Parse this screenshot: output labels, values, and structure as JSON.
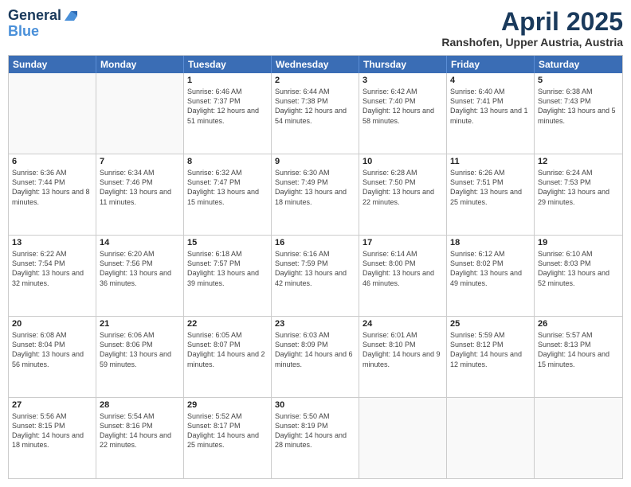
{
  "logo": {
    "line1": "General",
    "line2": "Blue"
  },
  "title": "April 2025",
  "subtitle": "Ranshofen, Upper Austria, Austria",
  "header_days": [
    "Sunday",
    "Monday",
    "Tuesday",
    "Wednesday",
    "Thursday",
    "Friday",
    "Saturday"
  ],
  "weeks": [
    [
      {
        "day": "",
        "sunrise": "",
        "sunset": "",
        "daylight": ""
      },
      {
        "day": "",
        "sunrise": "",
        "sunset": "",
        "daylight": ""
      },
      {
        "day": "1",
        "sunrise": "Sunrise: 6:46 AM",
        "sunset": "Sunset: 7:37 PM",
        "daylight": "Daylight: 12 hours and 51 minutes."
      },
      {
        "day": "2",
        "sunrise": "Sunrise: 6:44 AM",
        "sunset": "Sunset: 7:38 PM",
        "daylight": "Daylight: 12 hours and 54 minutes."
      },
      {
        "day": "3",
        "sunrise": "Sunrise: 6:42 AM",
        "sunset": "Sunset: 7:40 PM",
        "daylight": "Daylight: 12 hours and 58 minutes."
      },
      {
        "day": "4",
        "sunrise": "Sunrise: 6:40 AM",
        "sunset": "Sunset: 7:41 PM",
        "daylight": "Daylight: 13 hours and 1 minute."
      },
      {
        "day": "5",
        "sunrise": "Sunrise: 6:38 AM",
        "sunset": "Sunset: 7:43 PM",
        "daylight": "Daylight: 13 hours and 5 minutes."
      }
    ],
    [
      {
        "day": "6",
        "sunrise": "Sunrise: 6:36 AM",
        "sunset": "Sunset: 7:44 PM",
        "daylight": "Daylight: 13 hours and 8 minutes."
      },
      {
        "day": "7",
        "sunrise": "Sunrise: 6:34 AM",
        "sunset": "Sunset: 7:46 PM",
        "daylight": "Daylight: 13 hours and 11 minutes."
      },
      {
        "day": "8",
        "sunrise": "Sunrise: 6:32 AM",
        "sunset": "Sunset: 7:47 PM",
        "daylight": "Daylight: 13 hours and 15 minutes."
      },
      {
        "day": "9",
        "sunrise": "Sunrise: 6:30 AM",
        "sunset": "Sunset: 7:49 PM",
        "daylight": "Daylight: 13 hours and 18 minutes."
      },
      {
        "day": "10",
        "sunrise": "Sunrise: 6:28 AM",
        "sunset": "Sunset: 7:50 PM",
        "daylight": "Daylight: 13 hours and 22 minutes."
      },
      {
        "day": "11",
        "sunrise": "Sunrise: 6:26 AM",
        "sunset": "Sunset: 7:51 PM",
        "daylight": "Daylight: 13 hours and 25 minutes."
      },
      {
        "day": "12",
        "sunrise": "Sunrise: 6:24 AM",
        "sunset": "Sunset: 7:53 PM",
        "daylight": "Daylight: 13 hours and 29 minutes."
      }
    ],
    [
      {
        "day": "13",
        "sunrise": "Sunrise: 6:22 AM",
        "sunset": "Sunset: 7:54 PM",
        "daylight": "Daylight: 13 hours and 32 minutes."
      },
      {
        "day": "14",
        "sunrise": "Sunrise: 6:20 AM",
        "sunset": "Sunset: 7:56 PM",
        "daylight": "Daylight: 13 hours and 36 minutes."
      },
      {
        "day": "15",
        "sunrise": "Sunrise: 6:18 AM",
        "sunset": "Sunset: 7:57 PM",
        "daylight": "Daylight: 13 hours and 39 minutes."
      },
      {
        "day": "16",
        "sunrise": "Sunrise: 6:16 AM",
        "sunset": "Sunset: 7:59 PM",
        "daylight": "Daylight: 13 hours and 42 minutes."
      },
      {
        "day": "17",
        "sunrise": "Sunrise: 6:14 AM",
        "sunset": "Sunset: 8:00 PM",
        "daylight": "Daylight: 13 hours and 46 minutes."
      },
      {
        "day": "18",
        "sunrise": "Sunrise: 6:12 AM",
        "sunset": "Sunset: 8:02 PM",
        "daylight": "Daylight: 13 hours and 49 minutes."
      },
      {
        "day": "19",
        "sunrise": "Sunrise: 6:10 AM",
        "sunset": "Sunset: 8:03 PM",
        "daylight": "Daylight: 13 hours and 52 minutes."
      }
    ],
    [
      {
        "day": "20",
        "sunrise": "Sunrise: 6:08 AM",
        "sunset": "Sunset: 8:04 PM",
        "daylight": "Daylight: 13 hours and 56 minutes."
      },
      {
        "day": "21",
        "sunrise": "Sunrise: 6:06 AM",
        "sunset": "Sunset: 8:06 PM",
        "daylight": "Daylight: 13 hours and 59 minutes."
      },
      {
        "day": "22",
        "sunrise": "Sunrise: 6:05 AM",
        "sunset": "Sunset: 8:07 PM",
        "daylight": "Daylight: 14 hours and 2 minutes."
      },
      {
        "day": "23",
        "sunrise": "Sunrise: 6:03 AM",
        "sunset": "Sunset: 8:09 PM",
        "daylight": "Daylight: 14 hours and 6 minutes."
      },
      {
        "day": "24",
        "sunrise": "Sunrise: 6:01 AM",
        "sunset": "Sunset: 8:10 PM",
        "daylight": "Daylight: 14 hours and 9 minutes."
      },
      {
        "day": "25",
        "sunrise": "Sunrise: 5:59 AM",
        "sunset": "Sunset: 8:12 PM",
        "daylight": "Daylight: 14 hours and 12 minutes."
      },
      {
        "day": "26",
        "sunrise": "Sunrise: 5:57 AM",
        "sunset": "Sunset: 8:13 PM",
        "daylight": "Daylight: 14 hours and 15 minutes."
      }
    ],
    [
      {
        "day": "27",
        "sunrise": "Sunrise: 5:56 AM",
        "sunset": "Sunset: 8:15 PM",
        "daylight": "Daylight: 14 hours and 18 minutes."
      },
      {
        "day": "28",
        "sunrise": "Sunrise: 5:54 AM",
        "sunset": "Sunset: 8:16 PM",
        "daylight": "Daylight: 14 hours and 22 minutes."
      },
      {
        "day": "29",
        "sunrise": "Sunrise: 5:52 AM",
        "sunset": "Sunset: 8:17 PM",
        "daylight": "Daylight: 14 hours and 25 minutes."
      },
      {
        "day": "30",
        "sunrise": "Sunrise: 5:50 AM",
        "sunset": "Sunset: 8:19 PM",
        "daylight": "Daylight: 14 hours and 28 minutes."
      },
      {
        "day": "",
        "sunrise": "",
        "sunset": "",
        "daylight": ""
      },
      {
        "day": "",
        "sunrise": "",
        "sunset": "",
        "daylight": ""
      },
      {
        "day": "",
        "sunrise": "",
        "sunset": "",
        "daylight": ""
      }
    ]
  ]
}
